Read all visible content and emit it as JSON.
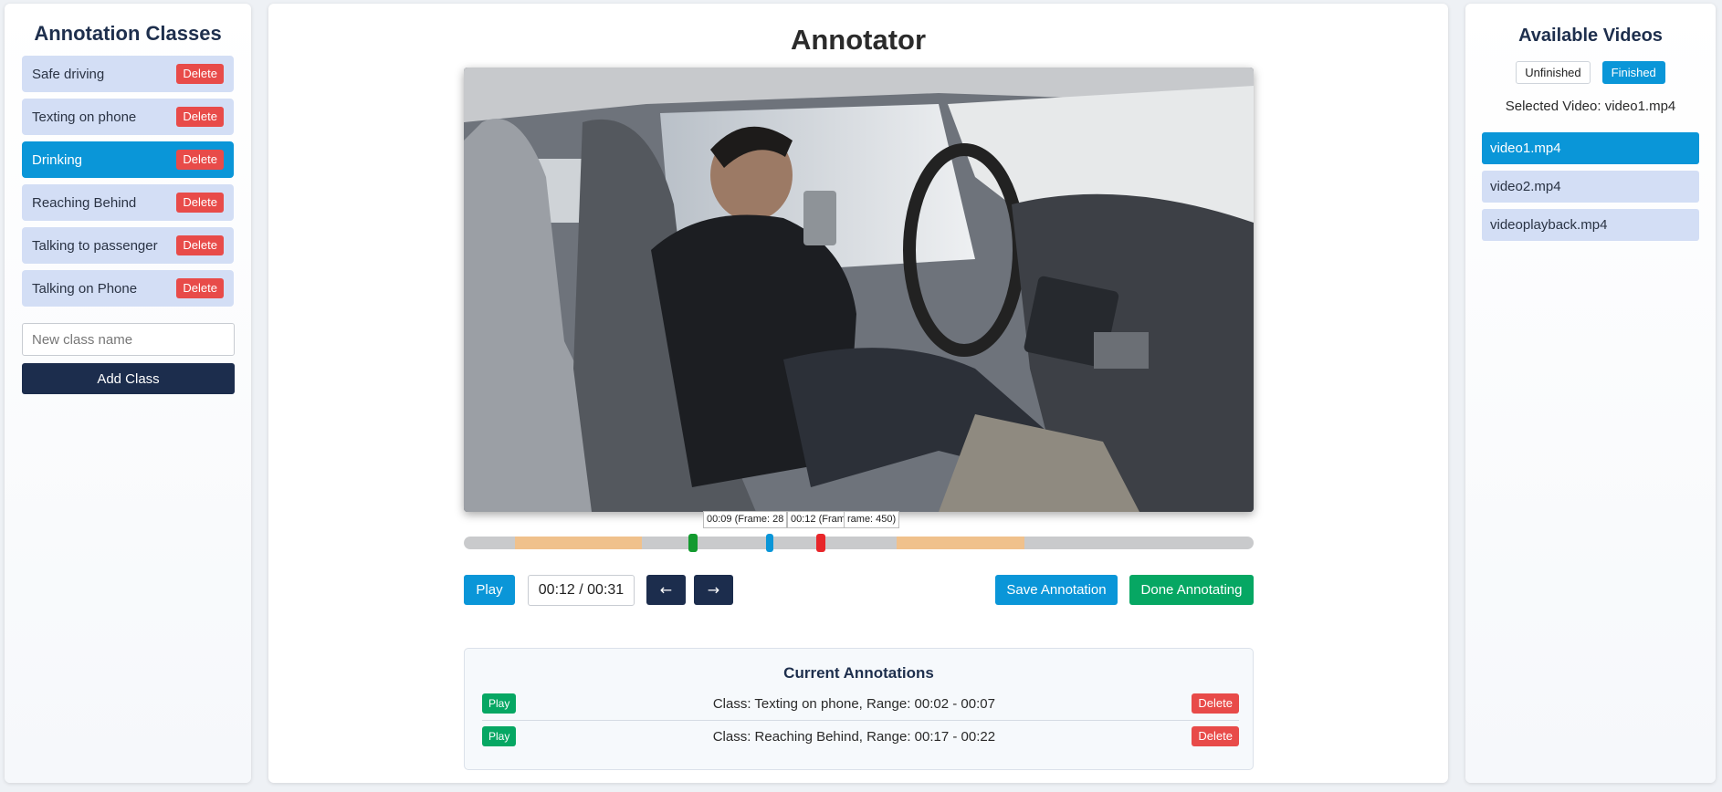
{
  "left_panel": {
    "title": "Annotation Classes",
    "classes": [
      {
        "label": "Safe driving",
        "delete_label": "Delete"
      },
      {
        "label": "Texting on phone",
        "delete_label": "Delete"
      },
      {
        "label": "Drinking",
        "delete_label": "Delete"
      },
      {
        "label": "Reaching Behind",
        "delete_label": "Delete"
      },
      {
        "label": "Talking to passenger",
        "delete_label": "Delete"
      },
      {
        "label": "Talking on Phone",
        "delete_label": "Delete"
      }
    ],
    "active_class": "Drinking",
    "new_class_placeholder": "New class name",
    "add_class_label": "Add Class"
  },
  "center": {
    "title": "Annotator",
    "timeline": {
      "tooltips": [
        "00:09 (Frame: 28",
        "00:12 (Frame: 384)",
        "rame: 450)"
      ],
      "duration_seconds": 31,
      "current_seconds": 12,
      "range_start_seconds": 9,
      "range_end_seconds": 14,
      "annotated_segments": [
        {
          "start": 2,
          "end": 7
        },
        {
          "start": 17,
          "end": 22
        }
      ]
    },
    "controls": {
      "play_label": "Play",
      "time_display": "00:12 / 00:31",
      "prev_label": "←",
      "next_label": "→",
      "save_label": "Save Annotation",
      "done_label": "Done Annotating"
    },
    "annotations": {
      "title": "Current Annotations",
      "rows": [
        {
          "play_label": "Play",
          "text": "Class: Texting on phone, Range: 00:02 - 00:07",
          "delete_label": "Delete"
        },
        {
          "play_label": "Play",
          "text": "Class: Reaching Behind, Range: 00:17 - 00:22",
          "delete_label": "Delete"
        }
      ]
    }
  },
  "right_panel": {
    "title": "Available Videos",
    "filters": [
      {
        "label": "Unfinished",
        "active": false
      },
      {
        "label": "Finished",
        "active": true
      }
    ],
    "selected_text": "Selected Video: video1.mp4",
    "videos": [
      "video1.mp4",
      "video2.mp4",
      "videoplayback.mp4"
    ],
    "active_video": "video1.mp4"
  },
  "colors": {
    "accent_blue": "#0a96d8",
    "navy": "#1c2d4d",
    "green": "#06a763",
    "danger": "#e84b49",
    "segment": "#f0c18c"
  }
}
